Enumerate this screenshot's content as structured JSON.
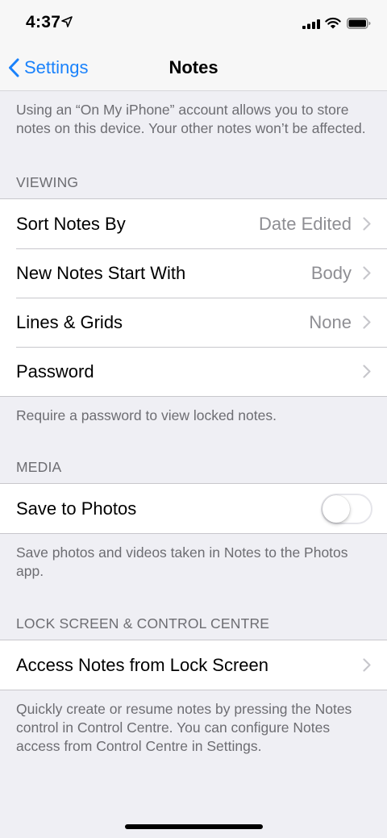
{
  "status_bar": {
    "time": "4:37",
    "icons": [
      "location-arrow-icon",
      "signal-bars-icon",
      "wifi-icon",
      "battery-icon"
    ]
  },
  "nav": {
    "back_label": "Settings",
    "title": "Notes"
  },
  "intro_text": "Using an “On My iPhone” account allows you to store notes on this device. Your other notes won’t be affected.",
  "viewing": {
    "header": "VIEWING",
    "rows": [
      {
        "label": "Sort Notes By",
        "value": "Date Edited"
      },
      {
        "label": "New Notes Start With",
        "value": "Body"
      },
      {
        "label": "Lines & Grids",
        "value": "None"
      },
      {
        "label": "Password",
        "value": ""
      }
    ],
    "footer": "Require a password to view locked notes."
  },
  "media": {
    "header": "MEDIA",
    "save_to_photos_label": "Save to Photos",
    "save_to_photos_on": false,
    "footer": "Save photos and videos taken in Notes to the Photos app."
  },
  "lock_screen": {
    "header": "LOCK SCREEN & CONTROL CENTRE",
    "row_label": "Access Notes from Lock Screen",
    "footer": "Quickly create or resume notes by pressing the Notes control in Control Centre. You can configure Notes access from Control Centre in Settings."
  },
  "colors": {
    "accent": "#1a82fb",
    "background": "#efeff4",
    "secondary_text": "#6d6d72",
    "value_text": "#8e8e93"
  }
}
